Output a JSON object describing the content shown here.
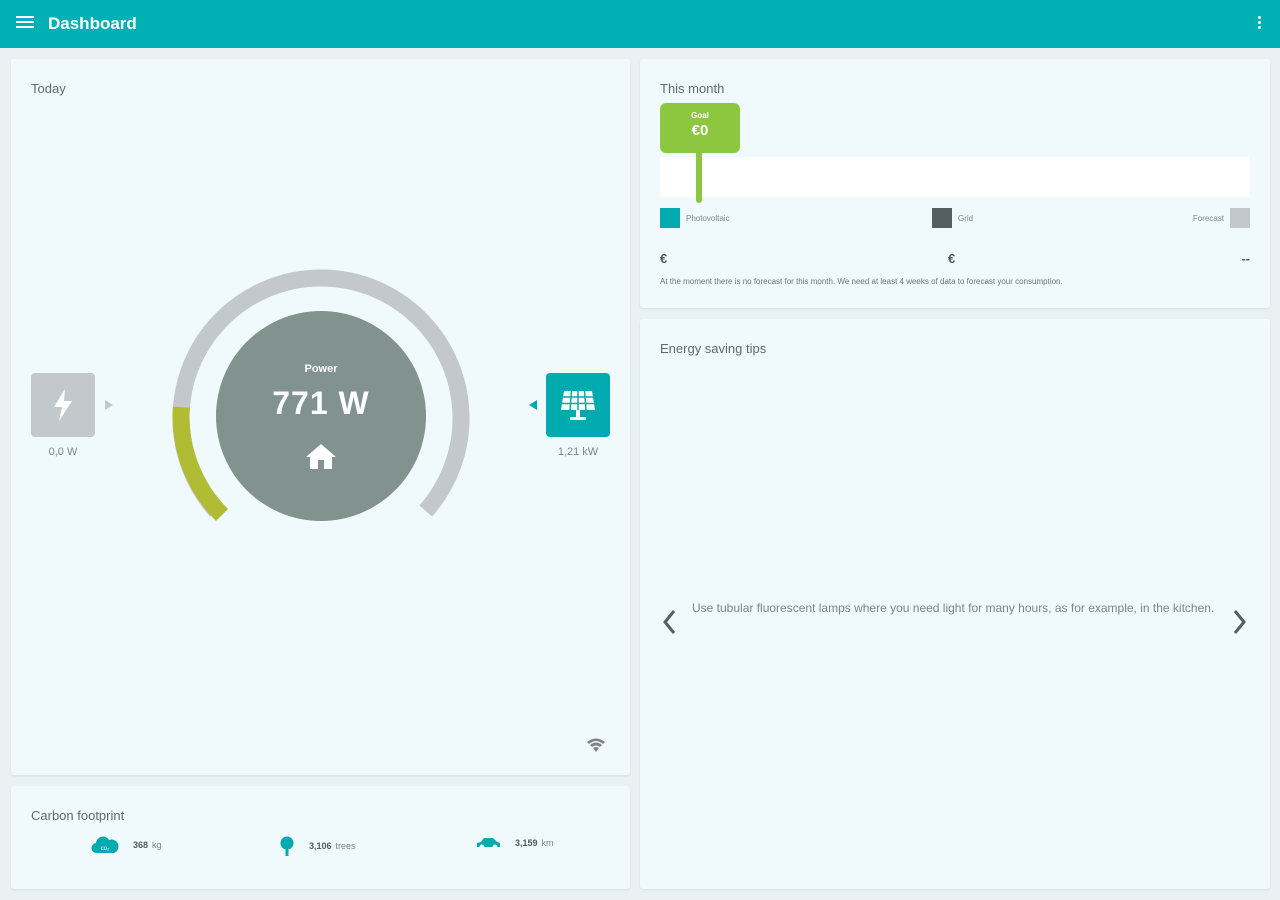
{
  "appbar": {
    "title": "Dashboard",
    "menu_icon": "menu-icon",
    "more_icon": "more-vert-icon"
  },
  "today": {
    "title": "Today",
    "grid": {
      "icon": "lightning-icon",
      "value": "0,0 W"
    },
    "solar": {
      "icon": "solar-panel-icon",
      "value": "1,21 kW"
    },
    "power": {
      "label": "Power",
      "value": "771 W",
      "icon": "home-icon"
    },
    "wifi_icon": "wifi-icon",
    "gauge_level": 0.18
  },
  "carbon": {
    "title": "Carbon footprint",
    "items": [
      {
        "icon": "cloud-co2-icon",
        "value": "368",
        "unit": "kg",
        "icon_label": "co₂"
      },
      {
        "icon": "tree-icon",
        "value": "3,106",
        "unit": "trees"
      },
      {
        "icon": "car-icon",
        "value": "3,159",
        "unit": "km"
      }
    ]
  },
  "month": {
    "title": "This month",
    "goal": {
      "label": "Goal",
      "value": "€0"
    },
    "legend": {
      "photovoltaic": "Photovoltaic",
      "grid": "Grid",
      "forecast": "Forecast"
    },
    "amounts": {
      "photovoltaic": "€",
      "grid": "€",
      "forecast": "--"
    },
    "note": "At the moment there is no forecast for this month. We need at least 4 weeks of data to forecast your consumption.",
    "colors": {
      "photovoltaic": "#00aaae",
      "grid": "#555e63",
      "forecast": "#c3c8cc",
      "goal": "#8dc63f"
    }
  },
  "tips": {
    "title": "Energy saving tips",
    "text": "Use tubular fluorescent lamps where you need light for many hours, as for example, in the kitchen.",
    "prev_icon": "chevron-left-icon",
    "next_icon": "chevron-right-icon"
  }
}
